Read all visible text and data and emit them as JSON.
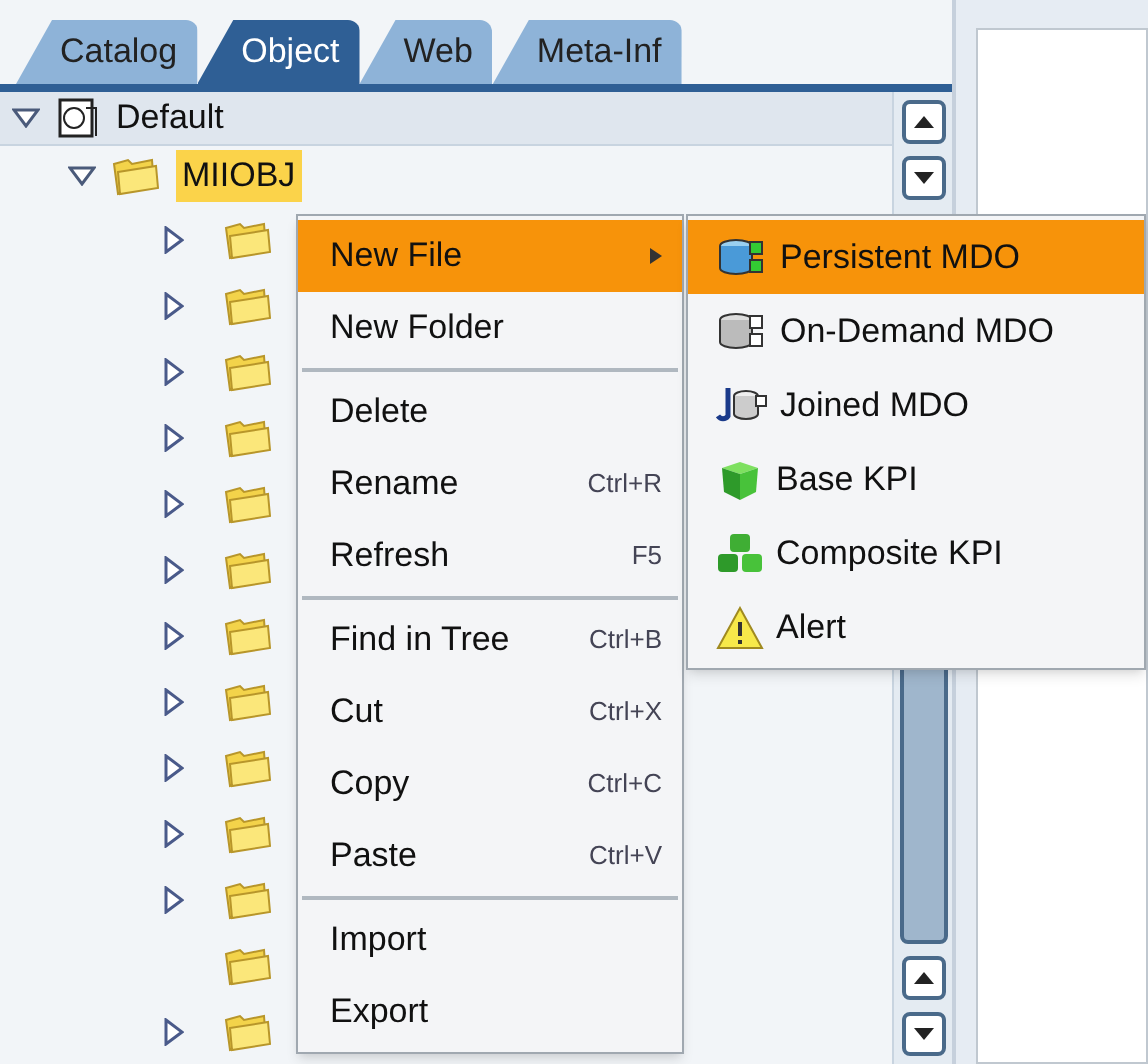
{
  "tabs": [
    {
      "label": "Catalog",
      "selected": false
    },
    {
      "label": "Object",
      "selected": true
    },
    {
      "label": "Web",
      "selected": false
    },
    {
      "label": "Meta-Inf",
      "selected": false
    }
  ],
  "tree": {
    "label": "Default",
    "expanded": true,
    "children": [
      {
        "label": "MIIOBJ",
        "expanded": true,
        "selected": true,
        "children": [
          {
            "has_children": true
          },
          {
            "has_children": true
          },
          {
            "has_children": true
          },
          {
            "has_children": true
          },
          {
            "has_children": true
          },
          {
            "has_children": true
          },
          {
            "has_children": true
          },
          {
            "has_children": true
          },
          {
            "has_children": true
          },
          {
            "has_children": true
          },
          {
            "has_children": true
          },
          {
            "has_children": false
          },
          {
            "has_children": true
          }
        ]
      }
    ]
  },
  "context_menu": {
    "items": [
      {
        "kind": "item",
        "label": "New File",
        "selected": true,
        "submenu": true
      },
      {
        "kind": "item",
        "label": "New Folder",
        "selected": false,
        "submenu": false
      },
      {
        "kind": "separator"
      },
      {
        "kind": "item",
        "label": "Delete",
        "selected": false,
        "submenu": false
      },
      {
        "kind": "item",
        "label": "Rename",
        "shortcut": "Ctrl+R",
        "selected": false,
        "submenu": false
      },
      {
        "kind": "item",
        "label": "Refresh",
        "shortcut": "F5",
        "selected": false,
        "submenu": false
      },
      {
        "kind": "separator"
      },
      {
        "kind": "item",
        "label": "Find in Tree",
        "shortcut": "Ctrl+B",
        "selected": false,
        "submenu": false
      },
      {
        "kind": "item",
        "label": "Cut",
        "shortcut": "Ctrl+X",
        "selected": false,
        "submenu": false
      },
      {
        "kind": "item",
        "label": "Copy",
        "shortcut": "Ctrl+C",
        "selected": false,
        "submenu": false
      },
      {
        "kind": "item",
        "label": "Paste",
        "shortcut": "Ctrl+V",
        "selected": false,
        "submenu": false
      },
      {
        "kind": "separator"
      },
      {
        "kind": "item",
        "label": "Import",
        "selected": false,
        "submenu": false
      },
      {
        "kind": "item",
        "label": "Export",
        "selected": false,
        "submenu": false
      }
    ]
  },
  "submenu": {
    "items": [
      {
        "kind": "persistent",
        "label": "Persistent MDO",
        "selected": true
      },
      {
        "kind": "on_demand",
        "label": "On-Demand MDO",
        "selected": false
      },
      {
        "kind": "joined",
        "label": "Joined MDO",
        "selected": false
      },
      {
        "kind": "base_kpi",
        "label": "Base KPI",
        "selected": false
      },
      {
        "kind": "composite_kpi",
        "label": "Composite KPI",
        "selected": false
      },
      {
        "kind": "alert",
        "label": "Alert",
        "selected": false
      }
    ]
  }
}
